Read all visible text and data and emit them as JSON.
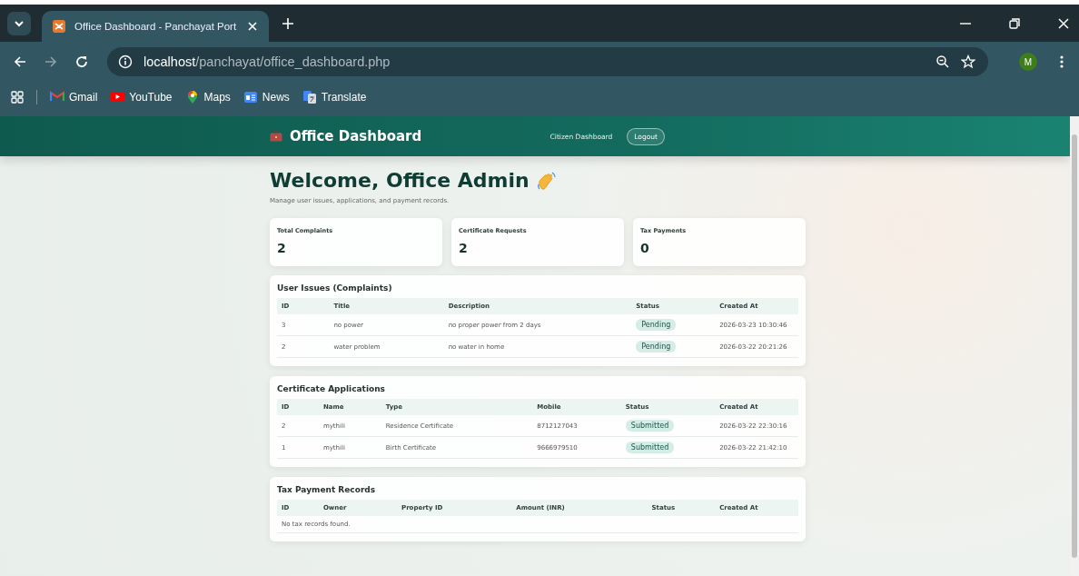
{
  "browser": {
    "tab": {
      "title": "Office Dashboard - Panchayat Port",
      "selected": true
    },
    "url_host": "localhost",
    "url_path": "/panchayat/office_dashboard.php",
    "profile_initial": "M",
    "bookmarks": [
      {
        "label": "Gmail"
      },
      {
        "label": "YouTube"
      },
      {
        "label": "Maps"
      },
      {
        "label": "News"
      },
      {
        "label": "Translate"
      }
    ]
  },
  "header": {
    "brand": "Office Dashboard",
    "nav": [
      {
        "label": "Citizen Dashboard",
        "kind": "link"
      },
      {
        "label": "Logout",
        "kind": "button"
      }
    ]
  },
  "welcome": {
    "title": "Welcome, Office Admin",
    "subtitle": "Manage user issues, applications, and payment records."
  },
  "stats": [
    {
      "label": "Total Complaints",
      "value": "2"
    },
    {
      "label": "Certificate Requests",
      "value": "2"
    },
    {
      "label": "Tax Payments",
      "value": "0"
    }
  ],
  "tables": [
    {
      "title": "User Issues (Complaints)",
      "columns": [
        {
          "label": "ID",
          "kind": "text"
        },
        {
          "label": "Title",
          "kind": "text"
        },
        {
          "label": "Description",
          "kind": "text"
        },
        {
          "label": "Status",
          "kind": "status"
        },
        {
          "label": "Created At",
          "kind": "text"
        }
      ],
      "rows": [
        [
          "3",
          "no power",
          "no proper power from 2 days",
          "Pending",
          "2026-03-23 10:30:46"
        ],
        [
          "2",
          "water problem",
          "no water in home",
          "Pending",
          "2026-03-22 20:21:26"
        ]
      ]
    },
    {
      "title": "Certificate Applications",
      "columns": [
        {
          "label": "ID",
          "kind": "text"
        },
        {
          "label": "Name",
          "kind": "text"
        },
        {
          "label": "Type",
          "kind": "text"
        },
        {
          "label": "Mobile",
          "kind": "text"
        },
        {
          "label": "Status",
          "kind": "status"
        },
        {
          "label": "Created At",
          "kind": "text"
        }
      ],
      "rows": [
        [
          "2",
          "mythili",
          "Residence Certificate",
          "8712127043",
          "Submitted",
          "2026-03-22 22:30:16"
        ],
        [
          "1",
          "mythili",
          "Birth Certificate",
          "9666979510",
          "Submitted",
          "2026-03-22 21:42:10"
        ]
      ]
    },
    {
      "title": "Tax Payment Records",
      "columns": [
        {
          "label": "ID"
        },
        {
          "label": "Owner"
        },
        {
          "label": "Property ID"
        },
        {
          "label": "Amount (INR)"
        },
        {
          "label": "Status"
        },
        {
          "label": "Created At"
        }
      ],
      "empty_message": "No tax records found."
    }
  ]
}
